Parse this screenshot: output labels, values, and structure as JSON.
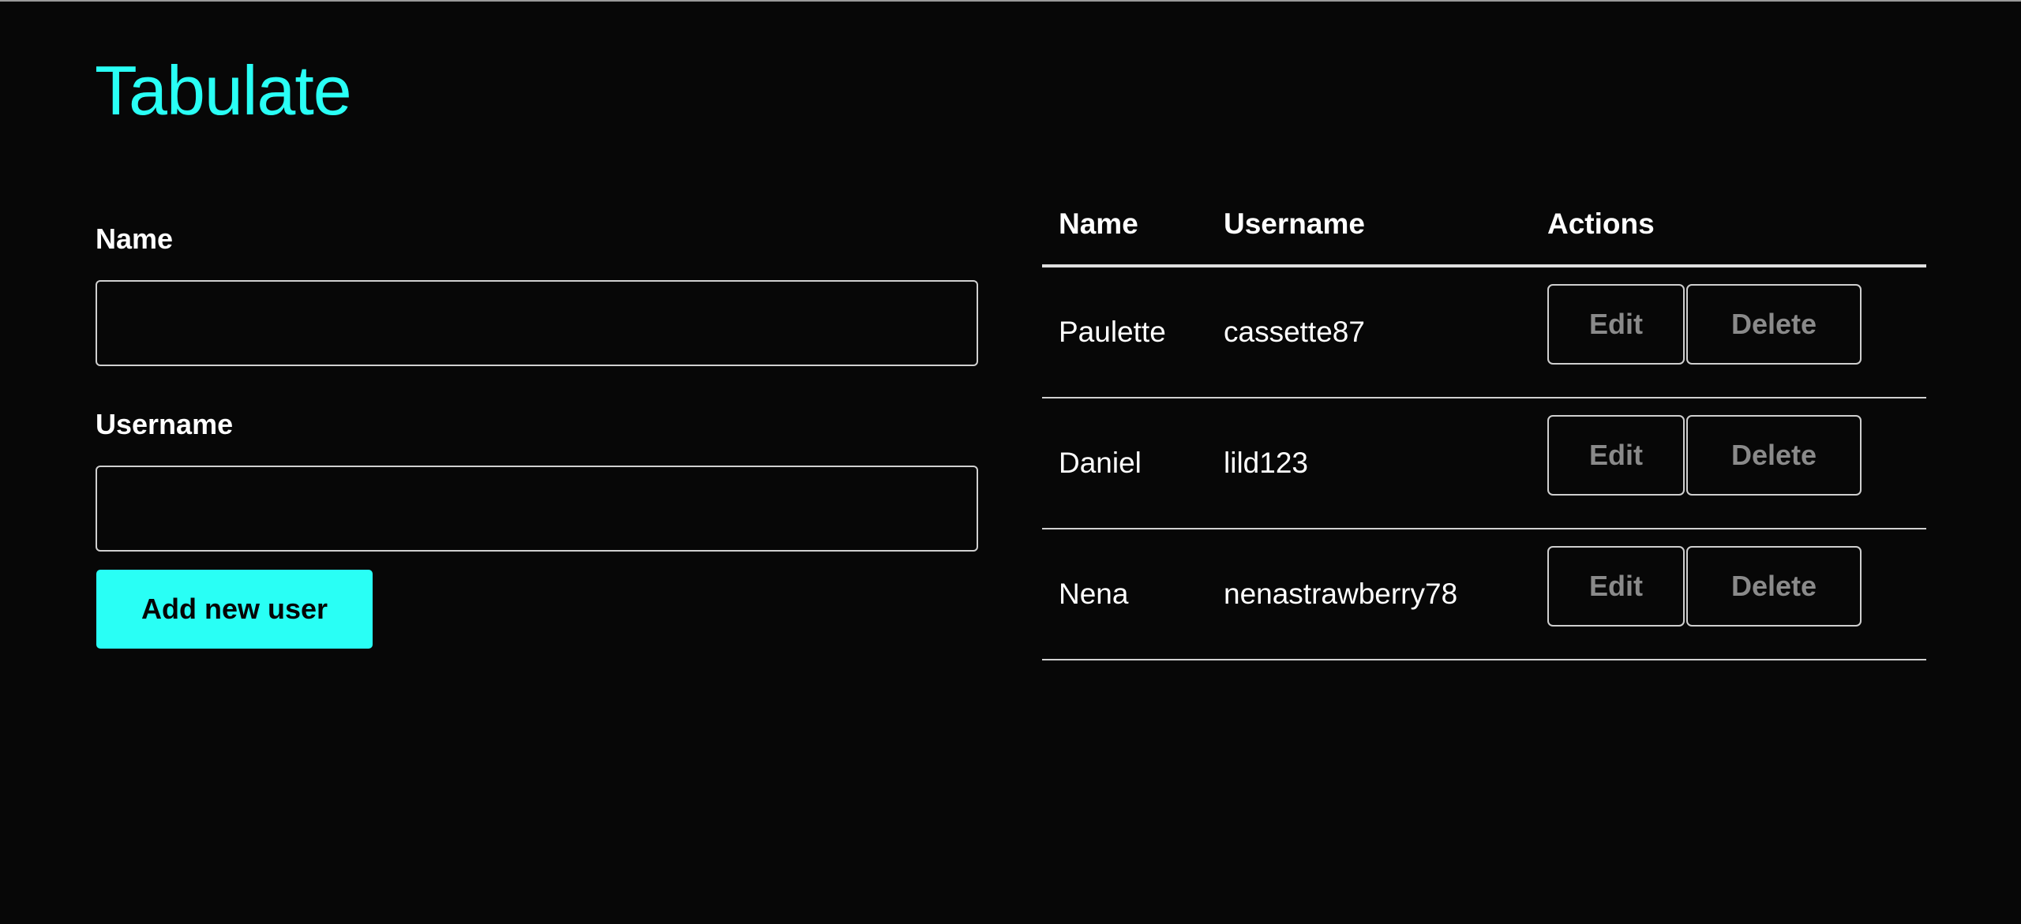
{
  "app": {
    "title": "Tabulate",
    "accent": "#29fff5"
  },
  "form": {
    "name_label": "Name",
    "name_value": "",
    "username_label": "Username",
    "username_value": "",
    "submit_label": "Add new user"
  },
  "table": {
    "headers": [
      "Name",
      "Username",
      "Actions"
    ],
    "rows": [
      {
        "name": "Paulette",
        "username": "cassette87",
        "edit": "Edit",
        "delete": "Delete"
      },
      {
        "name": "Daniel",
        "username": "lild123",
        "edit": "Edit",
        "delete": "Delete"
      },
      {
        "name": "Nena",
        "username": "nenastrawberry78",
        "edit": "Edit",
        "delete": "Delete"
      }
    ]
  }
}
